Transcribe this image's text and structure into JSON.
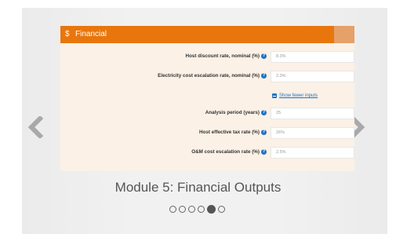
{
  "panel": {
    "icon": "dollar-icon",
    "icon_glyph": "$",
    "title": "Financial",
    "header_color": "#e8760c"
  },
  "fields": [
    {
      "label": "Host discount rate, nominal (%)",
      "value": "8.3%"
    },
    {
      "label": "Electricity cost escalation rate, nominal (%)",
      "value": "2.3%"
    }
  ],
  "toggle": {
    "label": "Show fewer inputs",
    "icon": "minus-square-icon"
  },
  "fields2": [
    {
      "label": "Analysis period (years)",
      "value": "25"
    },
    {
      "label": "Host effective tax rate (%)",
      "value": "26%"
    },
    {
      "label": "O&M cost escalation rate (%)",
      "value": "2.5%"
    }
  ],
  "caption": "Module 5: Financial Outputs",
  "pagination": {
    "total": 6,
    "active_index": 4
  },
  "navigation": {
    "prev_icon": "chevron-left-icon",
    "next_icon": "chevron-right-icon"
  }
}
